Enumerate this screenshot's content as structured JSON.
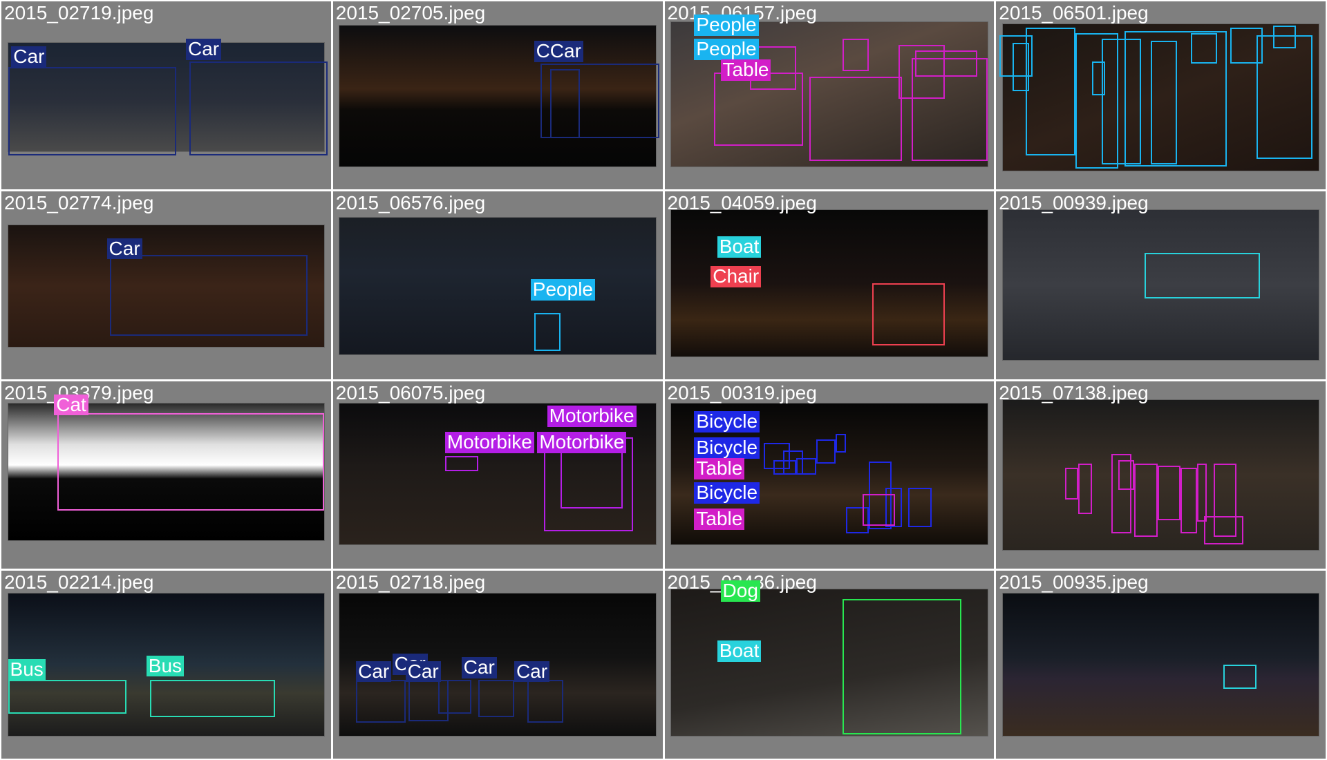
{
  "classes": {
    "Car": "#1a2a7a",
    "People": "#19b4f0",
    "Table": "#d21ec8",
    "Boat": "#28d2dc",
    "Chair": "#ee4050",
    "Cat": "#f060d8",
    "Motorbike": "#b41ee6",
    "Bicycle": "#1e28e6",
    "Bus": "#28dcb4",
    "Dog": "#28e650"
  },
  "cells": [
    {
      "filename": "2015_02719.jpeg",
      "labels": [
        "Car",
        "Car"
      ]
    },
    {
      "filename": "2015_02705.jpeg",
      "labels": [
        "CCar"
      ]
    },
    {
      "filename": "2015_06157.jpeg",
      "labels": [
        "People",
        "People",
        "Table"
      ]
    },
    {
      "filename": "2015_06501.jpeg",
      "labels": []
    },
    {
      "filename": "2015_02774.jpeg",
      "labels": [
        "Car"
      ]
    },
    {
      "filename": "2015_06576.jpeg",
      "labels": [
        "People"
      ]
    },
    {
      "filename": "2015_04059.jpeg",
      "labels": [
        "Boat",
        "Chair"
      ]
    },
    {
      "filename": "2015_00939.jpeg",
      "labels": []
    },
    {
      "filename": "2015_03379.jpeg",
      "labels": [
        "Cat"
      ]
    },
    {
      "filename": "2015_06075.jpeg",
      "labels": [
        "Motorbike",
        "Motorbike",
        "Motorbike"
      ]
    },
    {
      "filename": "2015_00319.jpeg",
      "labels": [
        "Bicycle",
        "Bicycle",
        "Table",
        "Bicycle",
        "Table"
      ]
    },
    {
      "filename": "2015_07138.jpeg",
      "labels": []
    },
    {
      "filename": "2015_02214.jpeg",
      "labels": [
        "Bus",
        "Bus"
      ]
    },
    {
      "filename": "2015_02718.jpeg",
      "labels": [
        "Car",
        "Car",
        "Car",
        "Car",
        "Car"
      ]
    },
    {
      "filename": "2015_02436.jpeg",
      "labels": [
        "Dog",
        "Boat"
      ]
    },
    {
      "filename": "2015_00935.jpeg",
      "labels": []
    }
  ]
}
